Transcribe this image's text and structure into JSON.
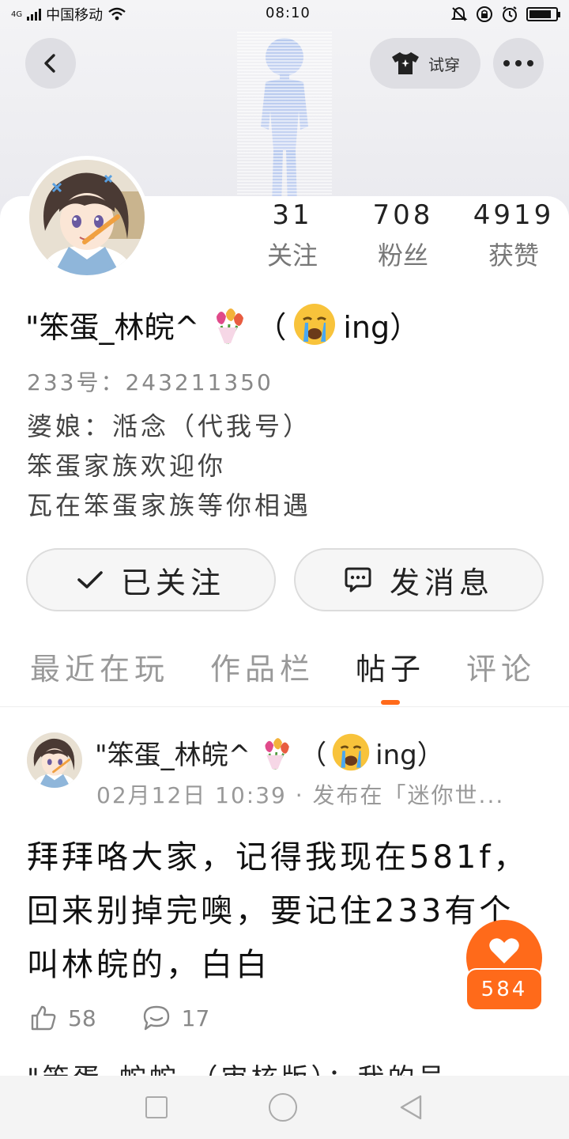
{
  "status_bar": {
    "network": "4G",
    "carrier": "中国移动",
    "time": "08:10",
    "battery_level": 0.85
  },
  "header": {
    "tryon_label": "试穿"
  },
  "profile": {
    "stats": [
      {
        "count": "31",
        "label": "关注"
      },
      {
        "count": "708",
        "label": "粉丝"
      },
      {
        "count": "4919",
        "label": "获赞"
      }
    ],
    "name_text": "\"笨蛋_林皖^",
    "name_suffix_open": "（",
    "name_suffix_tail": "ing）",
    "uid": "233号：243211350",
    "bio": [
      "婆娘：湉念（代我号）",
      "笨蛋家族欢迎你",
      "瓦在笨蛋家族等你相遇"
    ]
  },
  "buttons": {
    "following_label": "已关注",
    "message_label": "发消息"
  },
  "tabs": [
    {
      "label": "最近在玩",
      "active": false
    },
    {
      "label": "作品栏",
      "active": false
    },
    {
      "label": "帖子",
      "active": true
    },
    {
      "label": "评论",
      "active": false
    }
  ],
  "post": {
    "author_text": "\"笨蛋_林皖^",
    "author_suffix_open": "（",
    "author_suffix_tail": "ing）",
    "meta": "02月12日 10:39 · 发布在「迷你世...",
    "body": "拜拜咯大家，记得我现在581f，回来别掉完噢，要记住233有个叫林皖的，白白",
    "likes": "58",
    "comments": "17"
  },
  "next_post_preview": "\"笨蛋_蛇蛇 （审核版）：我的号",
  "fab": {
    "like_count": "584"
  },
  "colors": {
    "accent": "#ff6a1a"
  }
}
